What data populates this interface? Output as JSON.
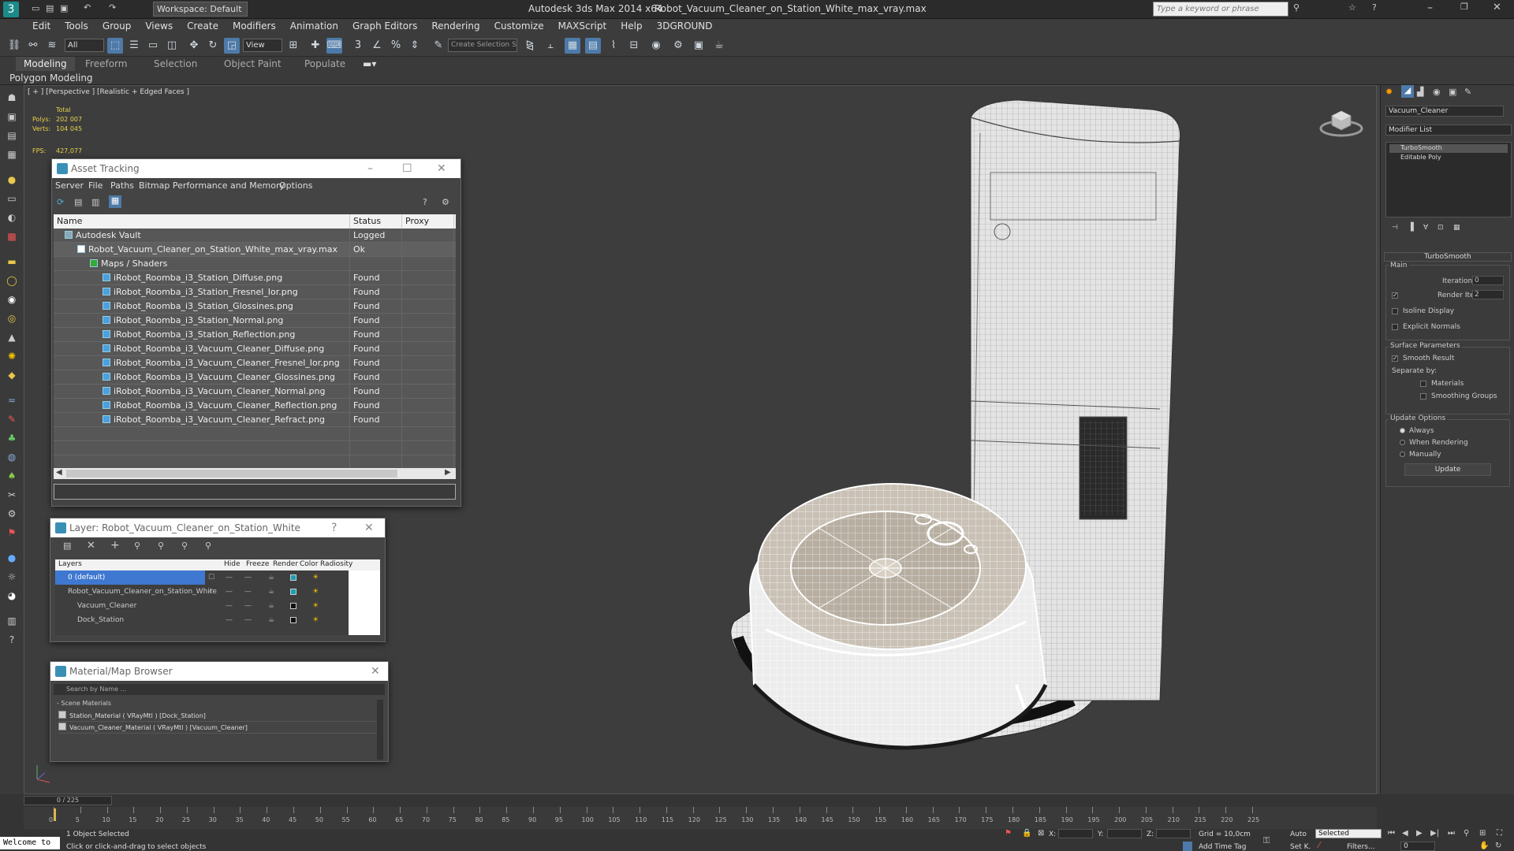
{
  "app": {
    "title": "Autodesk 3ds Max  2014 x64",
    "file": "Robot_Vacuum_Cleaner_on_Station_White_max_vray.max",
    "workspace": "Workspace: Default",
    "search_placeholder": "Type a keyword or phrase"
  },
  "menu": [
    "Edit",
    "Tools",
    "Group",
    "Views",
    "Create",
    "Modifiers",
    "Animation",
    "Graph Editors",
    "Rendering",
    "Customize",
    "MAXScript",
    "Help",
    "3DGROUND"
  ],
  "toolbar": {
    "filter": "All",
    "view": "View",
    "selection_set": "Create Selection S"
  },
  "ribbon": {
    "tabs": [
      "Modeling",
      "Freeform",
      "Selection",
      "Object Paint",
      "Populate"
    ],
    "sub": "Polygon Modeling"
  },
  "viewport": {
    "label": "[ + ] [Perspective ] [Realistic + Edged Faces ]",
    "stats": {
      "total_label": "Total",
      "polys_label": "Polys:",
      "polys": "202 007",
      "verts_label": "Verts:",
      "verts": "104 045",
      "fps_label": "FPS:",
      "fps": "427,077"
    }
  },
  "asset_tracking": {
    "title": "Asset Tracking",
    "menu": [
      "Server",
      "File",
      "Paths",
      "Bitmap Performance and Memory",
      "Options"
    ],
    "columns": [
      "Name",
      "Status",
      "Proxy Res..."
    ],
    "vault": {
      "name": "Autodesk Vault",
      "status": "Logged O..."
    },
    "file": {
      "name": "Robot_Vacuum_Cleaner_on_Station_White_max_vray.max",
      "status": "Ok"
    },
    "maps_group": "Maps / Shaders",
    "maps": [
      {
        "name": "iRobot_Roomba_i3_Station_Diffuse.png",
        "status": "Found"
      },
      {
        "name": "iRobot_Roomba_i3_Station_Fresnel_Ior.png",
        "status": "Found"
      },
      {
        "name": "iRobot_Roomba_i3_Station_Glossines.png",
        "status": "Found"
      },
      {
        "name": "iRobot_Roomba_i3_Station_Normal.png",
        "status": "Found"
      },
      {
        "name": "iRobot_Roomba_i3_Station_Reflection.png",
        "status": "Found"
      },
      {
        "name": "iRobot_Roomba_i3_Vacuum_Cleaner_Diffuse.png",
        "status": "Found"
      },
      {
        "name": "iRobot_Roomba_i3_Vacuum_Cleaner_Fresnel_Ior.png",
        "status": "Found"
      },
      {
        "name": "iRobot_Roomba_i3_Vacuum_Cleaner_Glossines.png",
        "status": "Found"
      },
      {
        "name": "iRobot_Roomba_i3_Vacuum_Cleaner_Normal.png",
        "status": "Found"
      },
      {
        "name": "iRobot_Roomba_i3_Vacuum_Cleaner_Reflection.png",
        "status": "Found"
      },
      {
        "name": "iRobot_Roomba_i3_Vacuum_Cleaner_Refract.png",
        "status": "Found"
      }
    ]
  },
  "layer_window": {
    "title": "Layer: Robot_Vacuum_Cleaner_on_Station_White",
    "columns": [
      "Layers",
      "Hide",
      "Freeze",
      "Render",
      "Color",
      "Radiosity"
    ],
    "layers": [
      {
        "name": "0 (default)",
        "color": "#1aa0b0"
      },
      {
        "name": "Robot_Vacuum_Cleaner_on_Station_White",
        "color": "#1aa0b0"
      },
      {
        "name": "Vacuum_Cleaner",
        "color": "#111111"
      },
      {
        "name": "Dock_Station",
        "color": "#111111"
      }
    ]
  },
  "material_browser": {
    "title": "Material/Map Browser",
    "search_placeholder": "Search by Name ...",
    "group": "- Scene Materials",
    "items": [
      "Station_Material  ( VRayMtl )  [Dock_Station]",
      "Vacuum_Cleaner_Material  ( VRayMtl )  [Vacuum_Cleaner]"
    ]
  },
  "command_panel": {
    "object_name": "Vacuum_Cleaner",
    "modifier_list": "Modifier List",
    "stack": [
      "TurboSmooth",
      "Editable Poly"
    ],
    "rollout": "TurboSmooth",
    "main": "Main",
    "iterations_label": "Iterations:",
    "iterations": "0",
    "render_iters_label": "Render Iters:",
    "render_iters": "2",
    "isoline": "Isoline Display",
    "explicit_normals": "Explicit Normals",
    "surface_params": "Surface Parameters",
    "smooth_result": "Smooth Result",
    "separate_by": "Separate by:",
    "materials": "Materials",
    "smoothing_groups": "Smoothing Groups",
    "update_options": "Update Options",
    "always": "Always",
    "when_rendering": "When Rendering",
    "manually": "Manually",
    "update_button": "Update"
  },
  "status": {
    "frame": "0 / 225",
    "ticks": [
      "0",
      "5",
      "10",
      "15",
      "20",
      "25",
      "30",
      "35",
      "40",
      "45",
      "50",
      "55",
      "60",
      "65",
      "70",
      "75",
      "80",
      "85",
      "90",
      "95",
      "100",
      "105",
      "110",
      "115",
      "120",
      "125",
      "130",
      "135",
      "140",
      "145",
      "150",
      "155",
      "160",
      "165",
      "170",
      "175",
      "180",
      "185",
      "190",
      "195",
      "200",
      "205",
      "210",
      "215",
      "220",
      "225"
    ],
    "selected": "1 Object Selected",
    "hint": "Click or click-and-drag to select objects",
    "welcome": "Welcome to",
    "x_label": "X:",
    "y_label": "Y:",
    "z_label": "Z:",
    "grid": "Grid = 10,0cm",
    "add_time_tag": "Add Time Tag",
    "auto": "Auto",
    "set_key": "Set K.",
    "key_mode": "Selected",
    "filters": "Filters...",
    "frame_field": "0"
  }
}
